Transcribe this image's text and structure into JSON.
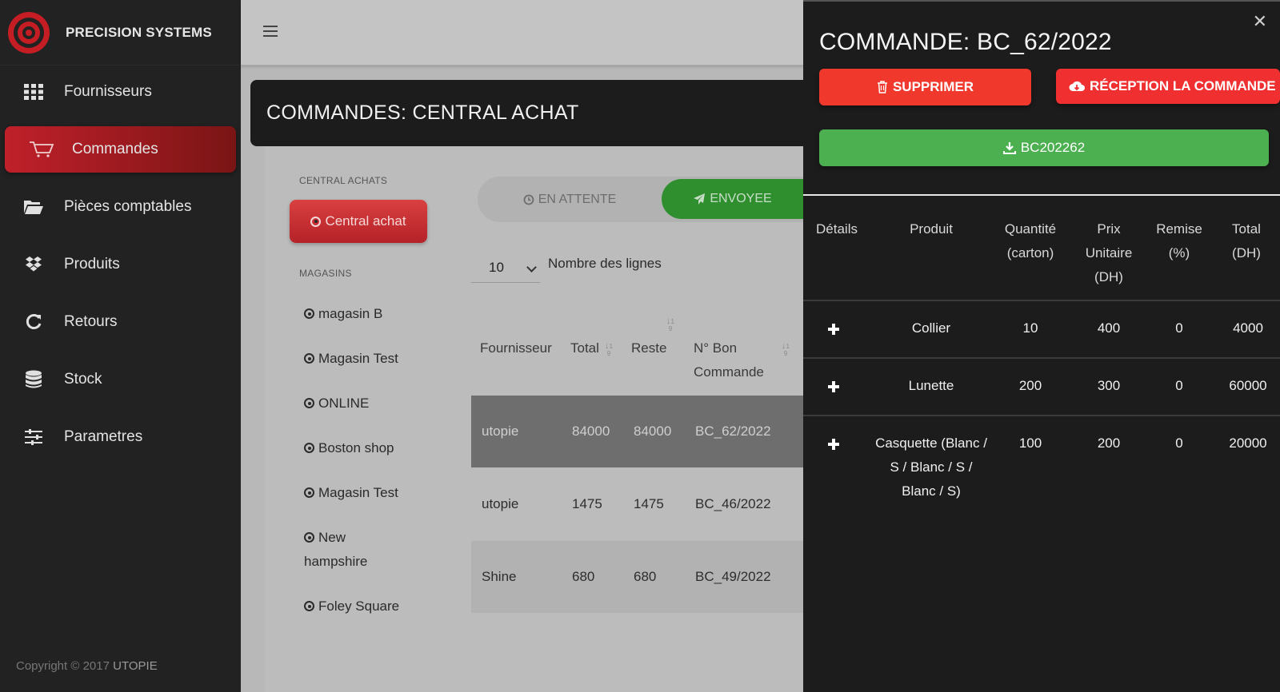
{
  "brand": {
    "name": "PRECISION SYSTEMS"
  },
  "sidebar": {
    "items": [
      {
        "label": "Fournisseurs",
        "icon": "grid-icon"
      },
      {
        "label": "Commandes",
        "icon": "cart-icon",
        "active": true
      },
      {
        "label": "Pièces comptables",
        "icon": "folder-icon"
      },
      {
        "label": "Produits",
        "icon": "dropbox-icon"
      },
      {
        "label": "Retours",
        "icon": "refresh-icon"
      },
      {
        "label": "Stock",
        "icon": "database-icon"
      },
      {
        "label": "Parametres",
        "icon": "sliders-icon"
      }
    ],
    "copyright": "Copyright © 2017",
    "copyright_brand": "UTOPIE"
  },
  "page": {
    "title": "COMMANDES: CENTRAL ACHAT",
    "central_label": "CENTRAL ACHATS",
    "central_button": "Central achat",
    "stores_label": "MAGASINS",
    "stores": [
      "magasin B",
      "Magasin Test",
      "ONLINE",
      "Boston shop",
      "Magasin Test",
      "New hampshire",
      "Foley Square"
    ],
    "tabs": {
      "waiting": "EN ATTENTE",
      "sent": "ENVOYEE"
    },
    "rows_value": "10",
    "rows_label": "Nombre des lignes",
    "columns": {
      "fournisseur": "Fournisseur",
      "total": "Total",
      "reste": "Reste",
      "bon": "N° Bon Commande"
    },
    "orders": [
      {
        "fournisseur": "utopie",
        "total": "84000",
        "reste": "84000",
        "bon": "BC_62/2022"
      },
      {
        "fournisseur": "utopie",
        "total": "1475",
        "reste": "1475",
        "bon": "BC_46/2022"
      },
      {
        "fournisseur": "Shine",
        "total": "680",
        "reste": "680",
        "bon": "BC_49/2022"
      }
    ]
  },
  "panel": {
    "title": "COMMANDE: BC_62/2022",
    "delete_label": "SUPPRIMER",
    "reception_label": "RÉCEPTION LA COMMANDE",
    "download_label": "BC202262",
    "columns": {
      "details": "Détails",
      "produit": "Produit",
      "quantite": "Quantité (carton)",
      "prix": "Prix Unitaire (DH)",
      "remise": "Remise (%)",
      "total": "Total (DH)"
    },
    "lines": [
      {
        "produit": "Collier",
        "quantite": "10",
        "prix": "400",
        "remise": "0",
        "total": "4000"
      },
      {
        "produit": "Lunette",
        "quantite": "200",
        "prix": "300",
        "remise": "0",
        "total": "60000"
      },
      {
        "produit": "Casquette (Blanc / S / Blanc / S / Blanc / S)",
        "quantite": "100",
        "prix": "200",
        "remise": "0",
        "total": "20000"
      }
    ]
  },
  "colors": {
    "accent_red": "#d32f2f",
    "success_green": "#4caf50",
    "sidebar_bg": "#222222",
    "panel_bg": "#1c1c1c"
  }
}
